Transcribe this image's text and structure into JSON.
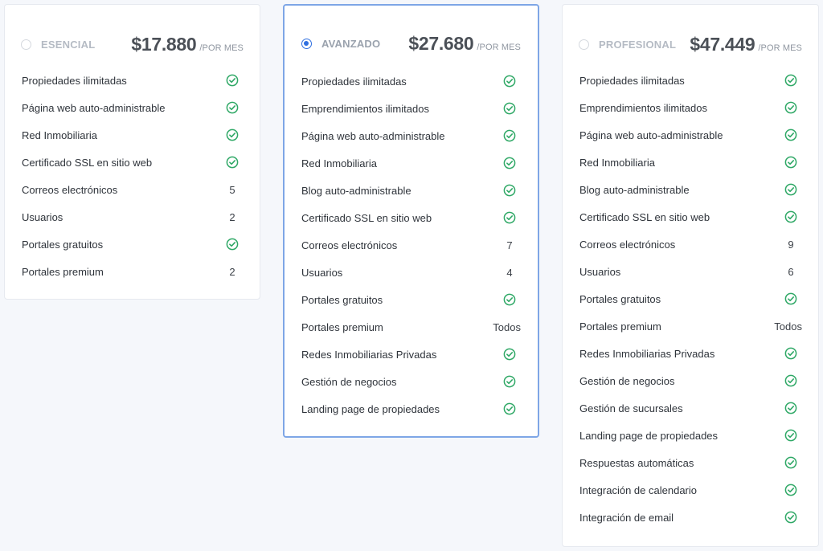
{
  "plans": [
    {
      "id": "esencial",
      "name": "ESENCIAL",
      "price": "$17.880",
      "period": "/POR MES",
      "selected": false,
      "features": [
        {
          "label": "Propiedades ilimitadas",
          "value": "check"
        },
        {
          "label": "Página web auto-administrable",
          "value": "check"
        },
        {
          "label": "Red Inmobiliaria",
          "value": "check"
        },
        {
          "label": "Certificado SSL en sitio web",
          "value": "check"
        },
        {
          "label": "Correos electrónicos",
          "value": "5"
        },
        {
          "label": "Usuarios",
          "value": "2"
        },
        {
          "label": "Portales gratuitos",
          "value": "check"
        },
        {
          "label": "Portales premium",
          "value": "2"
        }
      ]
    },
    {
      "id": "avanzado",
      "name": "AVANZADO",
      "price": "$27.680",
      "period": "/POR MES",
      "selected": true,
      "features": [
        {
          "label": "Propiedades ilimitadas",
          "value": "check"
        },
        {
          "label": "Emprendimientos ilimitados",
          "value": "check"
        },
        {
          "label": "Página web auto-administrable",
          "value": "check"
        },
        {
          "label": "Red Inmobiliaria",
          "value": "check"
        },
        {
          "label": "Blog auto-administrable",
          "value": "check"
        },
        {
          "label": "Certificado SSL en sitio web",
          "value": "check"
        },
        {
          "label": "Correos electrónicos",
          "value": "7"
        },
        {
          "label": "Usuarios",
          "value": "4"
        },
        {
          "label": "Portales gratuitos",
          "value": "check"
        },
        {
          "label": "Portales premium",
          "value": "Todos"
        },
        {
          "label": "Redes Inmobiliarias Privadas",
          "value": "check"
        },
        {
          "label": "Gestión de negocios",
          "value": "check"
        },
        {
          "label": "Landing page de propiedades",
          "value": "check"
        }
      ]
    },
    {
      "id": "profesional",
      "name": "PROFESIONAL",
      "price": "$47.449",
      "period": "/POR MES",
      "selected": false,
      "features": [
        {
          "label": "Propiedades ilimitadas",
          "value": "check"
        },
        {
          "label": "Emprendimientos ilimitados",
          "value": "check"
        },
        {
          "label": "Página web auto-administrable",
          "value": "check"
        },
        {
          "label": "Red Inmobiliaria",
          "value": "check"
        },
        {
          "label": "Blog auto-administrable",
          "value": "check"
        },
        {
          "label": "Certificado SSL en sitio web",
          "value": "check"
        },
        {
          "label": "Correos electrónicos",
          "value": "9"
        },
        {
          "label": "Usuarios",
          "value": "6"
        },
        {
          "label": "Portales gratuitos",
          "value": "check"
        },
        {
          "label": "Portales premium",
          "value": "Todos"
        },
        {
          "label": "Redes Inmobiliarias Privadas",
          "value": "check"
        },
        {
          "label": "Gestión de negocios",
          "value": "check"
        },
        {
          "label": "Gestión de sucursales",
          "value": "check"
        },
        {
          "label": "Landing page de propiedades",
          "value": "check"
        },
        {
          "label": "Respuestas automáticas",
          "value": "check"
        },
        {
          "label": "Integración de calendario",
          "value": "check"
        },
        {
          "label": "Integración de email",
          "value": "check"
        }
      ]
    }
  ],
  "colors": {
    "check": "#2fa866",
    "radio_selected": "#2f6fe0",
    "selected_border": "#7ea6e6"
  },
  "icons": {
    "check": "check-circle-icon"
  }
}
